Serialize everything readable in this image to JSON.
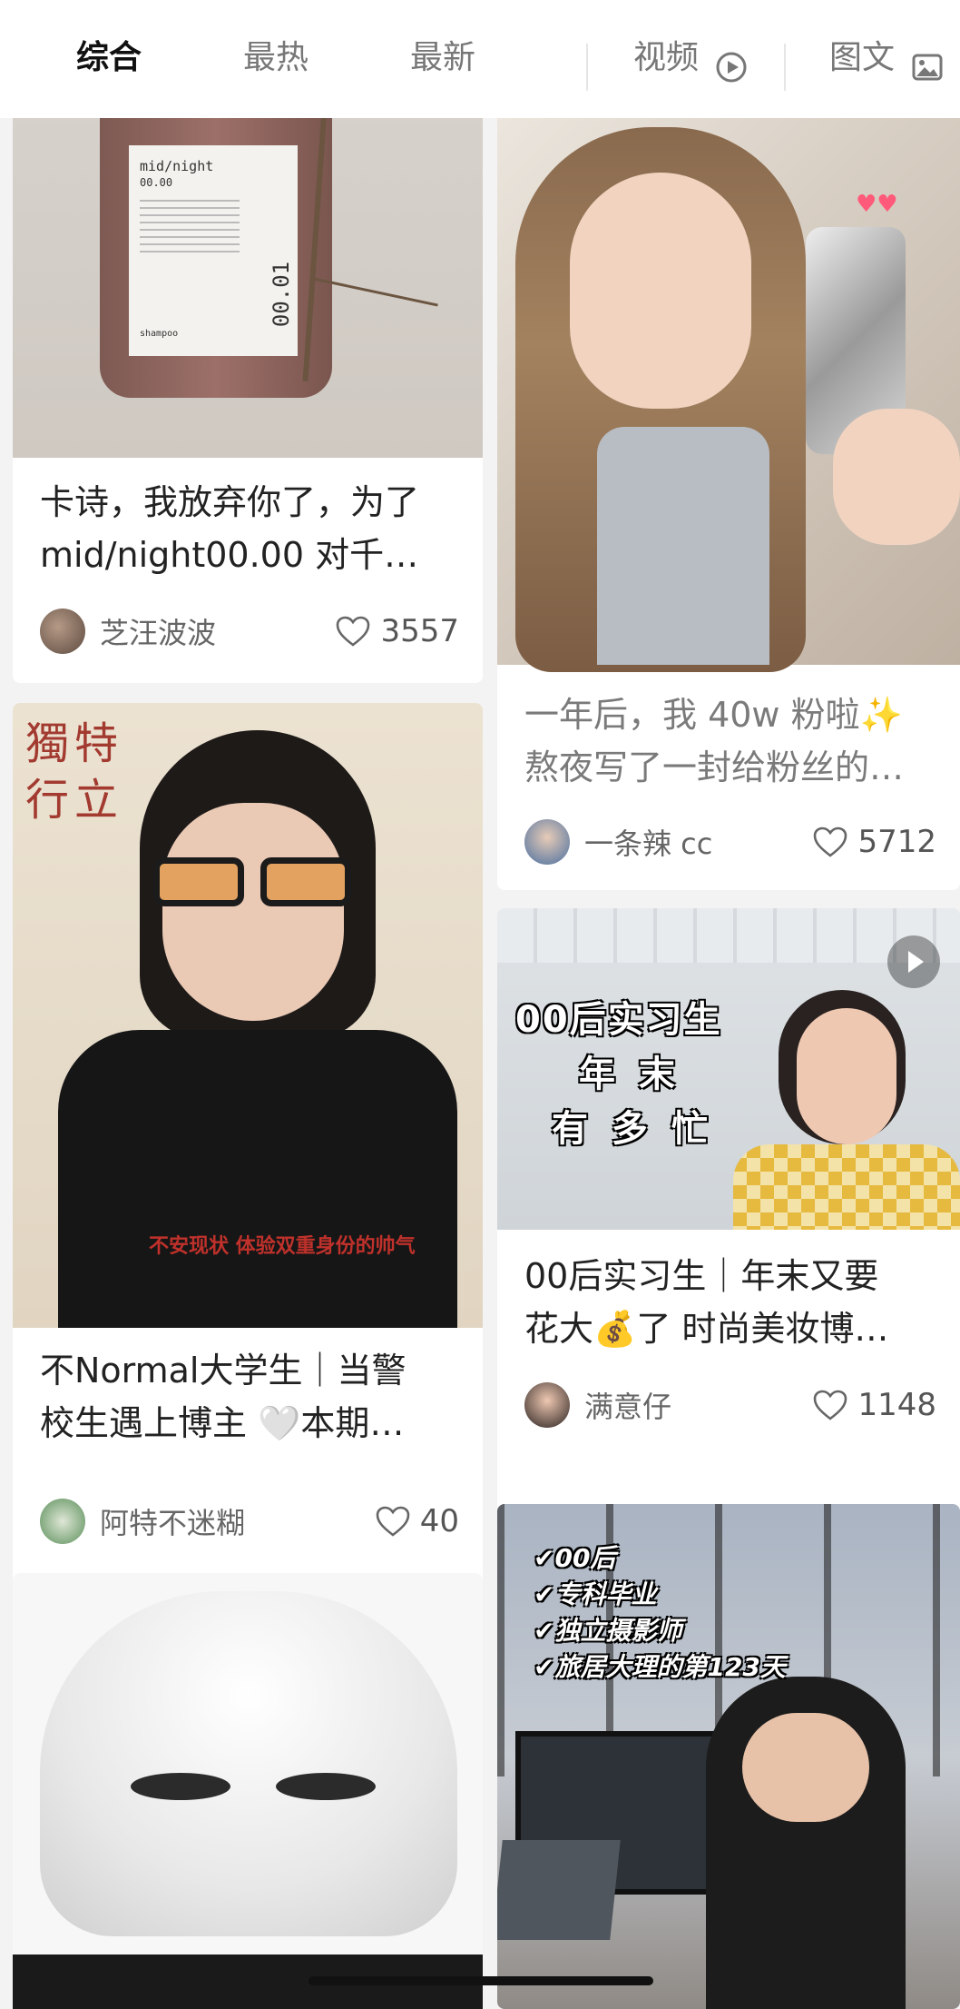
{
  "tabs": {
    "comprehensive": "综合",
    "hottest": "最热",
    "newest": "最新",
    "video": "视频",
    "image_text": "图文"
  },
  "cards": [
    {
      "title_line1": "卡诗，我放弃你了，为了",
      "title_line2": "mid/night00.00 对千…",
      "author": "芝汪波波",
      "likes": "3557",
      "image_text": {
        "brand": "mid/night",
        "sub": "00.00",
        "side": "00.01",
        "product": "shampoo"
      }
    },
    {
      "title_line1": "一年后，我 40w 粉啦✨",
      "title_line2": "熬夜写了一封给粉丝的…",
      "author": "一条辣 cc",
      "likes": "5712"
    },
    {
      "title_line1": "不Normal大学生｜当警",
      "title_line2": "校生遇上博主 🤍本期…",
      "author": "阿特不迷糊",
      "likes": "40",
      "image_text": {
        "calligraphy": "獨特行立",
        "caption": "不安现状  体验双重身份的帅气"
      }
    },
    {
      "title_line1": "00后实习生｜年末又要",
      "title_line2": "花大💰了 时尚美妆博…",
      "author": "满意仔",
      "likes": "1148",
      "image_text": {
        "line1": "00后实习生",
        "line2": "年 末",
        "line3": "有 多 忙"
      }
    },
    {
      "image_text": {
        "l1": "✔00后",
        "l2": "✔专科毕业",
        "l3": "✔独立摄影师",
        "l4": "✔旅居大理的第123天"
      }
    }
  ],
  "colors": {
    "accent_text": "#111111",
    "inactive_text": "#777777",
    "page_bg": "#f3f3f3"
  }
}
